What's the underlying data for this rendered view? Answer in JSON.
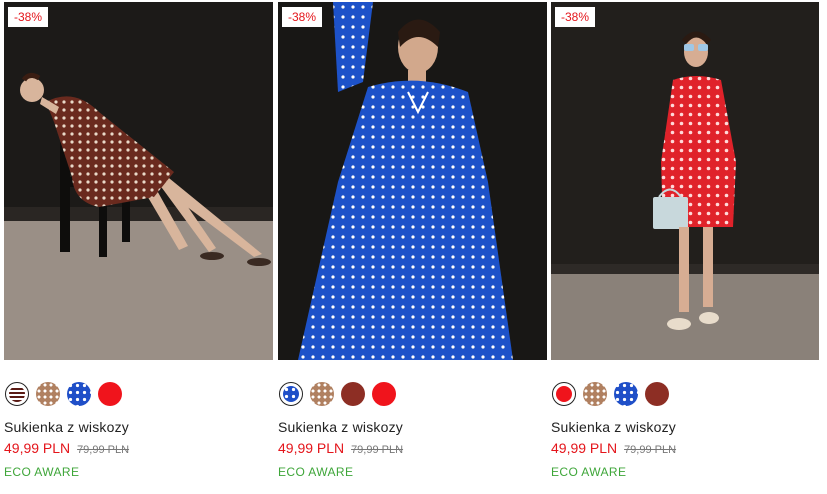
{
  "products": [
    {
      "badge": "-38%",
      "name": "Sukienka z wiskozy",
      "price": "49,99 PLN",
      "old_price": "79,99 PLN",
      "eco": "ECO AWARE",
      "swatches": [
        "brown-stripe",
        "tan-dots",
        "blue-dots",
        "red"
      ]
    },
    {
      "badge": "-38%",
      "name": "Sukienka z wiskozy",
      "price": "49,99 PLN",
      "old_price": "79,99 PLN",
      "eco": "ECO AWARE",
      "swatches": [
        "blue-dots",
        "tan-dots",
        "maroon",
        "red"
      ]
    },
    {
      "badge": "-38%",
      "name": "Sukienka z wiskozy",
      "price": "49,99 PLN",
      "old_price": "79,99 PLN",
      "eco": "ECO AWARE",
      "swatches": [
        "red",
        "tan-dots",
        "blue-dots",
        "maroon"
      ]
    }
  ],
  "colors": {
    "accent_red": "#e4151b",
    "eco_green": "#3fa63a"
  }
}
